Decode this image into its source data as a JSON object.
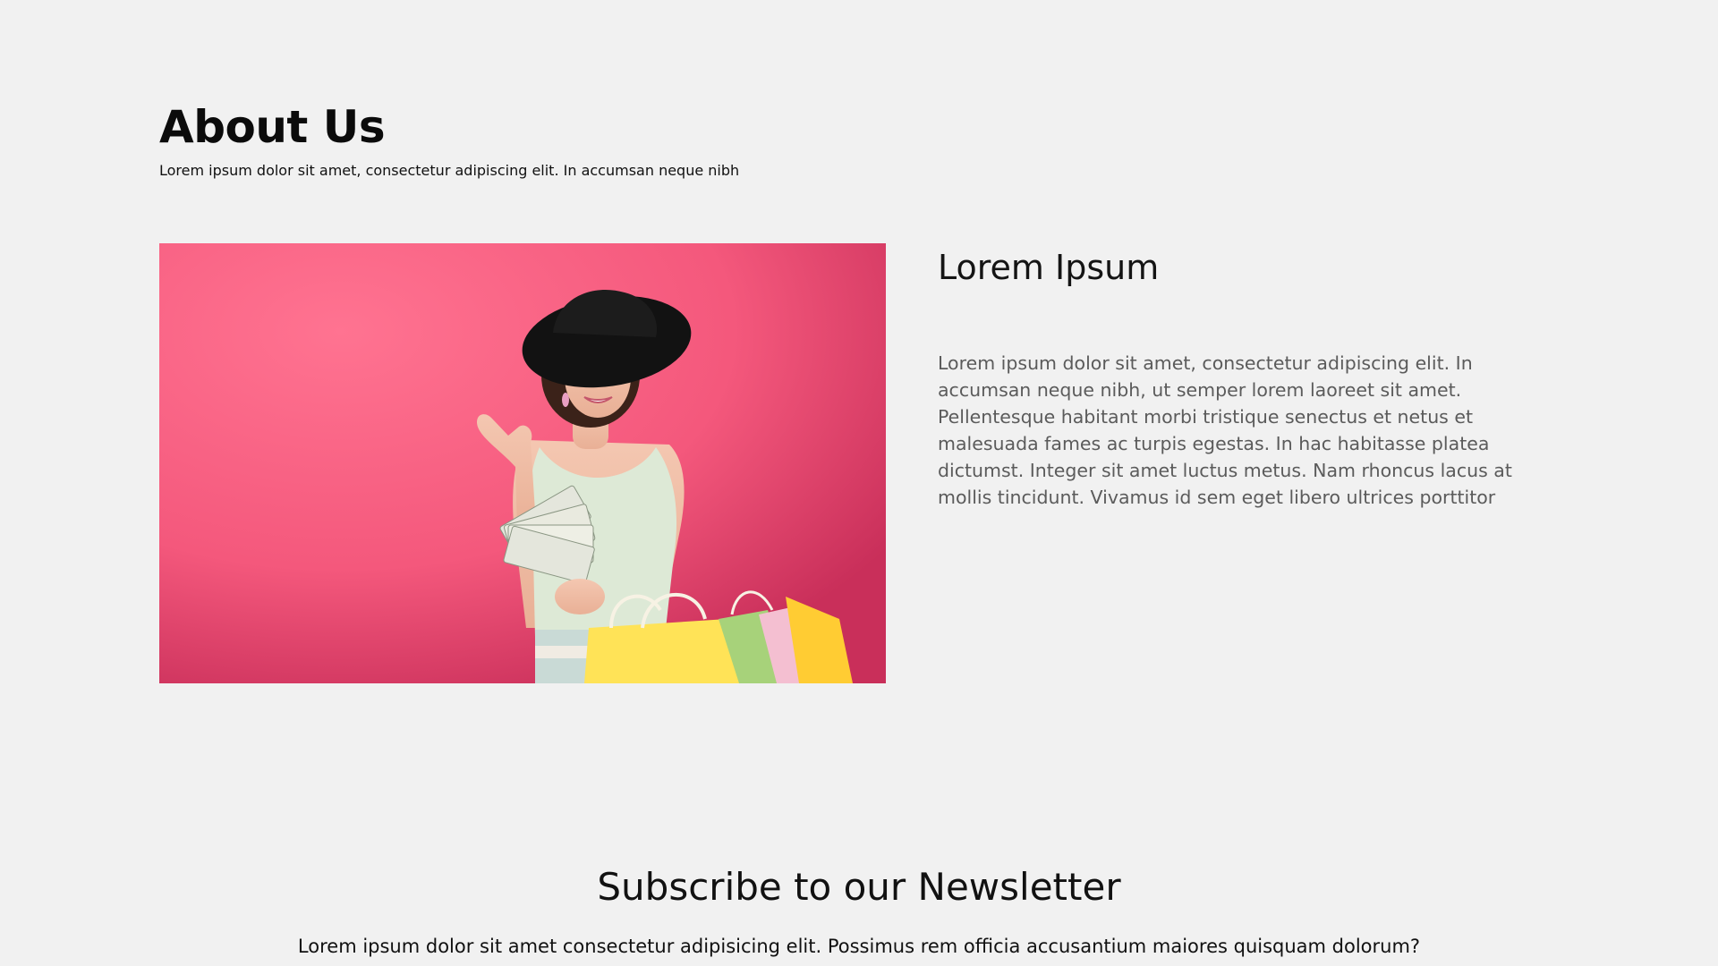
{
  "about": {
    "title": "About Us",
    "subtitle": "Lorem ipsum dolor sit amet, consectetur adipiscing elit. In accumsan neque nibh"
  },
  "content": {
    "heading": "Lorem Ipsum",
    "body": "Lorem ipsum dolor sit amet, consectetur adipiscing elit. In accumsan neque nibh, ut semper lorem laoreet sit amet. Pellentesque habitant morbi tristique senectus et netus et malesuada fames ac turpis egestas. In hac habitasse platea dictumst. Integer sit amet luctus metus. Nam rhoncus lacus at mollis tincidunt. Vivamus id sem eget libero ultrices porttitor"
  },
  "newsletter": {
    "title": "Subscribe to our Newsletter",
    "text": "Lorem ipsum dolor sit amet consectetur adipisicing elit. Possimus rem officia accusantium maiores quisquam dolorum?"
  },
  "image": {
    "icon": "shopping-woman-photo",
    "background_color": "#f56a88"
  }
}
